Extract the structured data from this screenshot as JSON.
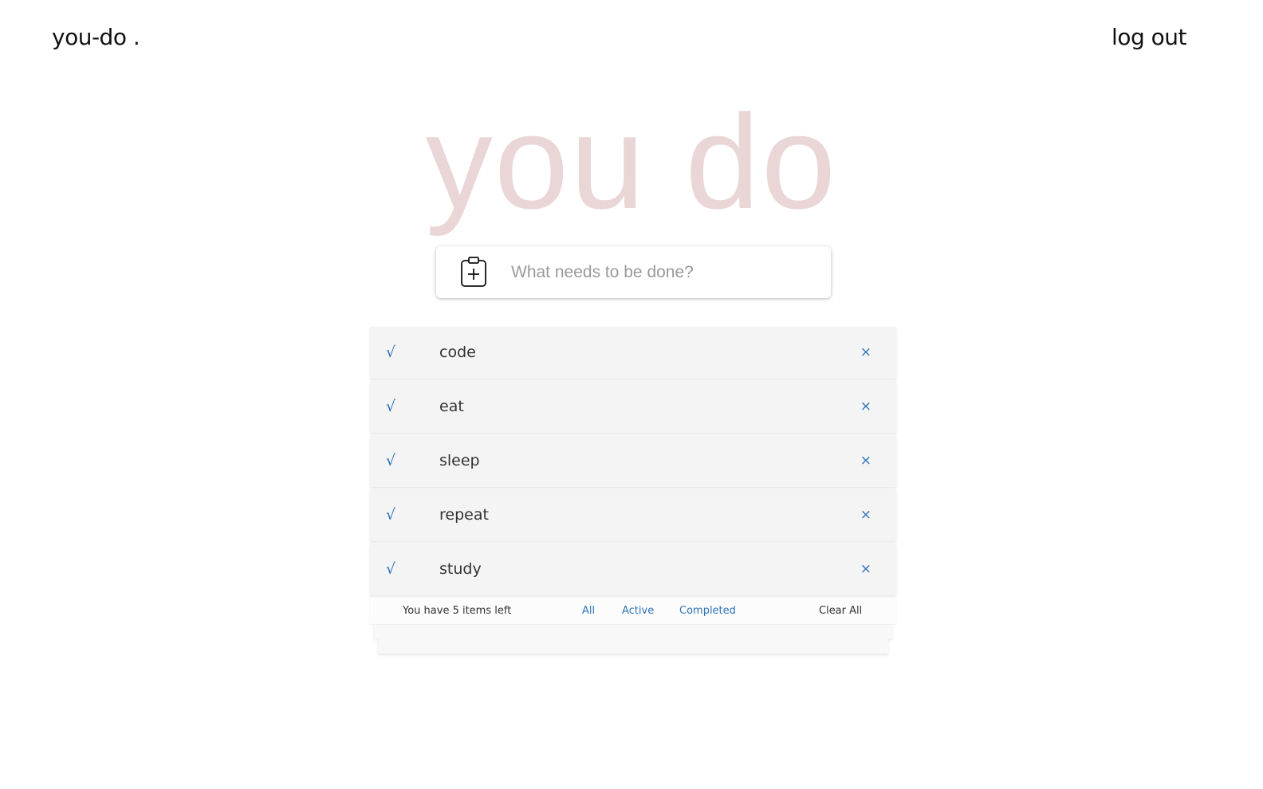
{
  "header": {
    "brand": "you-do .",
    "logout_label": "log out"
  },
  "hero": {
    "title": "you do",
    "color": "#ead6d6"
  },
  "new_todo": {
    "icon": "clipboard-plus-icon",
    "placeholder": "What needs to be done?",
    "value": ""
  },
  "todos": [
    {
      "check_mark": "√",
      "label": "code",
      "remove_mark": "×"
    },
    {
      "check_mark": "√",
      "label": "eat",
      "remove_mark": "×"
    },
    {
      "check_mark": "√",
      "label": "sleep",
      "remove_mark": "×"
    },
    {
      "check_mark": "√",
      "label": "repeat",
      "remove_mark": "×"
    },
    {
      "check_mark": "√",
      "label": "study",
      "remove_mark": "×"
    }
  ],
  "footer": {
    "count_text": "You have 5 items left",
    "filters": {
      "all": "All",
      "active": "Active",
      "completed": "Completed"
    },
    "clear_label": "Clear All"
  },
  "colors": {
    "accent": "#2f73b8",
    "item_bg": "#f4f4f4"
  }
}
